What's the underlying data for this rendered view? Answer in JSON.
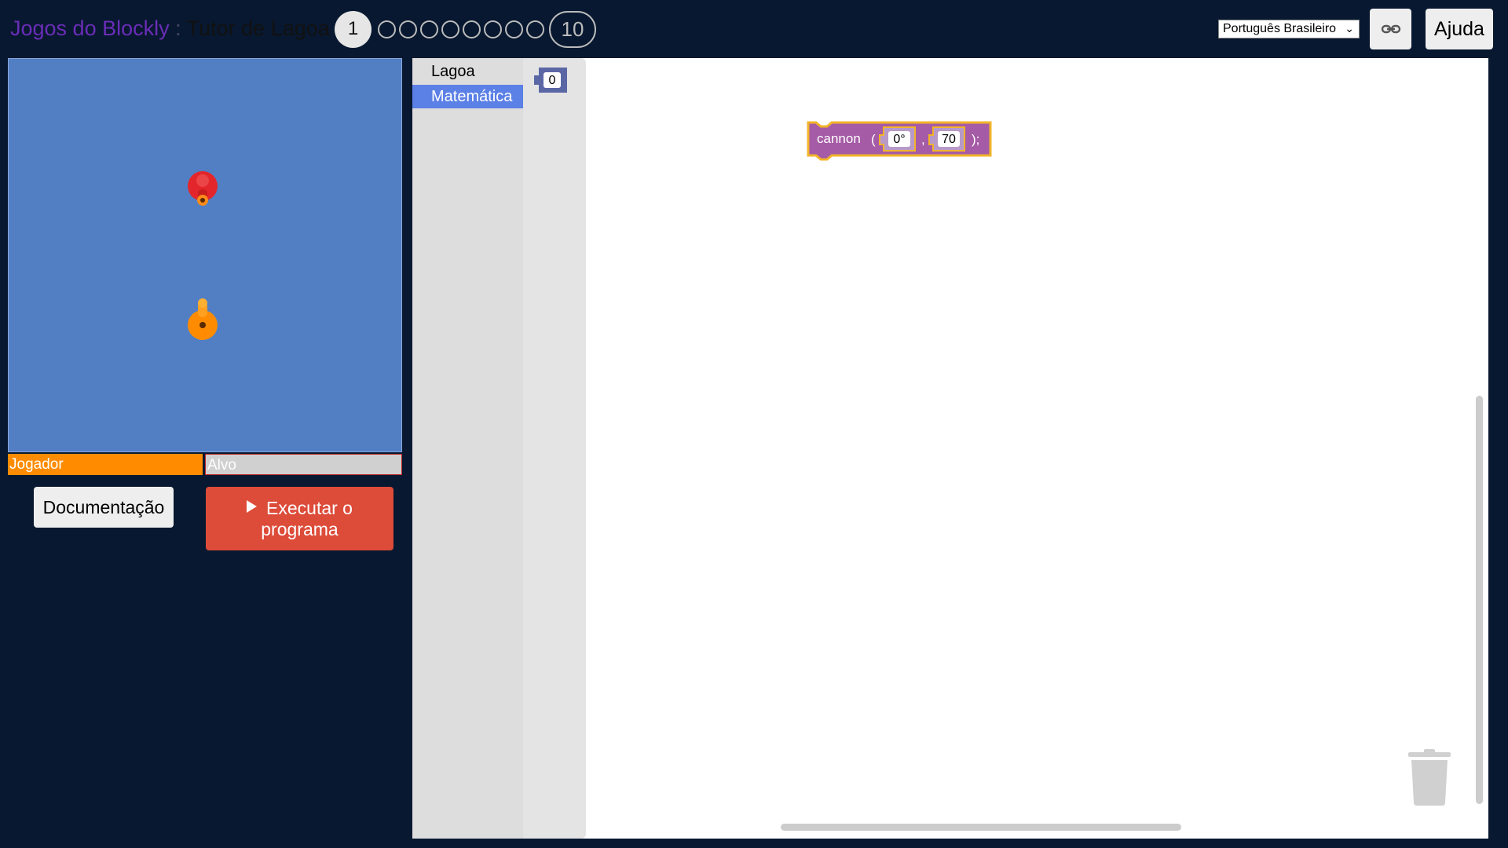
{
  "header": {
    "brand": "Jogos do Blockly",
    "separator": " : ",
    "game": "Tutor de Lagoa",
    "levels": {
      "current": "1",
      "last": "10"
    },
    "language": "Português Brasileiro",
    "help_label": "Ajuda"
  },
  "visualization": {
    "health": {
      "player_label": "Jogador",
      "target_label": "Alvo"
    },
    "colors": {
      "water": "#527fc4",
      "player": "#ff8c00",
      "target": "#e3262b"
    }
  },
  "buttons": {
    "documentation": "Documentação",
    "run_line1": "Executar o",
    "run_line2": "programa"
  },
  "toolbox": {
    "categories": [
      {
        "label": "Lagoa",
        "selected": false
      },
      {
        "label": "Matemática",
        "selected": true
      }
    ]
  },
  "flyout": {
    "number_value": "0"
  },
  "workspace": {
    "block": {
      "function": "cannon",
      "open_paren": "(",
      "angle": "0°",
      "comma": ",",
      "range": "70",
      "close": ");"
    }
  }
}
